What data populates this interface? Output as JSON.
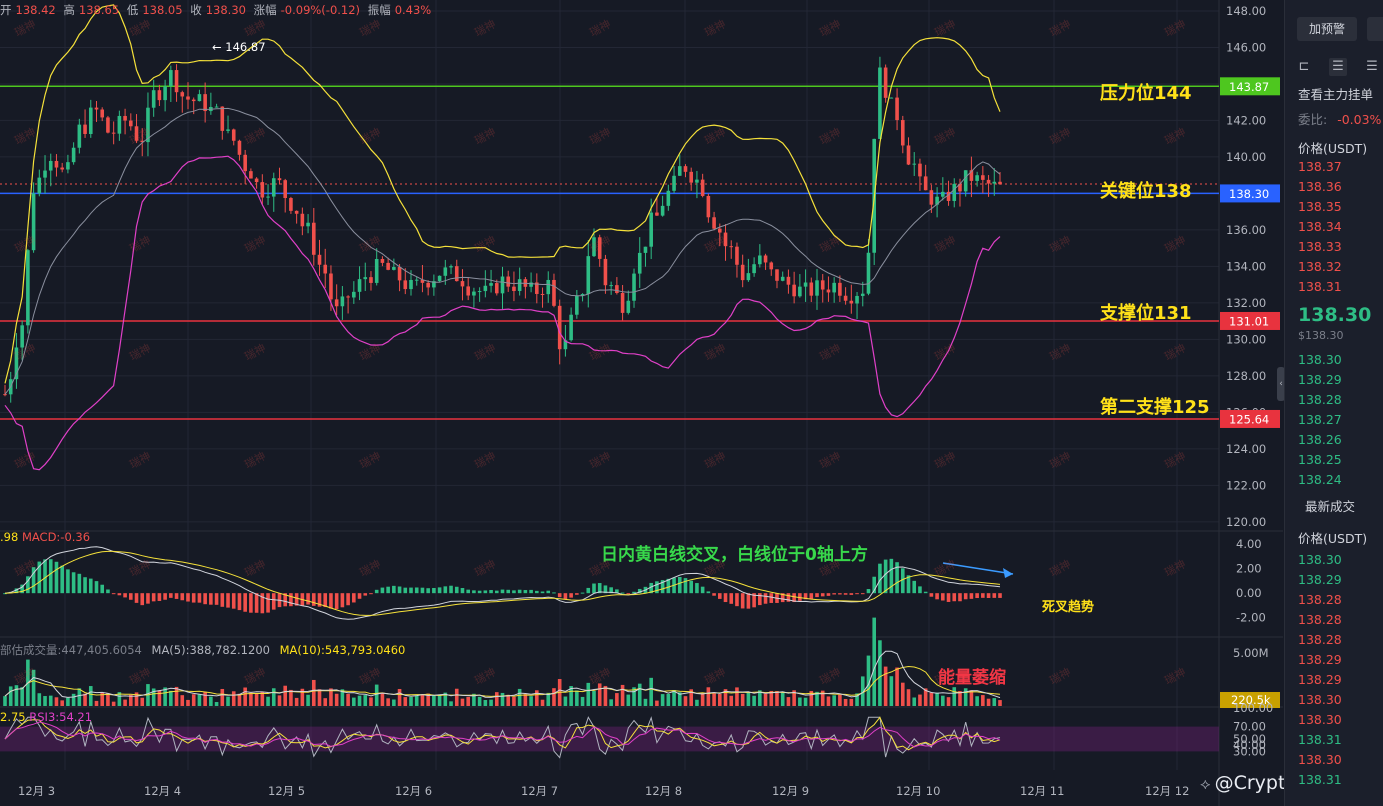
{
  "ohlc": {
    "open_label": "开",
    "open": "138.42",
    "high_label": "高",
    "high": "138.65",
    "low_label": "低",
    "low": "138.05",
    "close_label": "收",
    "close": "138.30",
    "change_label": "涨幅",
    "change": "-0.09%(-0.12)",
    "amp_label": "振幅",
    "amp": "0.43%"
  },
  "annotations": {
    "resistance": "压力位144",
    "key": "关键位138",
    "support": "支撑位131",
    "support2": "第二支撑125",
    "macd_note": "日内黄白线交叉，白线位于0轴上方",
    "death_cross": "死叉趋势",
    "volume_note": "能量萎缩"
  },
  "indicators": {
    "macd_prefix": ".98",
    "macd_label": "MACD:-0.36",
    "vol_label": "部估成交量:447,405.6054",
    "ma5_label": "MA(5):388,782.1200",
    "ma10_label": "MA(10):543,793.0460",
    "rsi_prefix": "2.75",
    "rsi_label": "RSI3:54.21"
  },
  "watermark": "瑞神",
  "brand": "@Crypto瑞神",
  "sidebar": {
    "alert_button": "加预警",
    "order_book_title": "查看主力挂单",
    "ratio_label": "委比:",
    "ratio_value": "-0.03%",
    "price_header": "价格(USDT)",
    "asks": [
      "138.37",
      "138.36",
      "138.35",
      "138.34",
      "138.33",
      "138.32",
      "138.31"
    ],
    "last_price": "138.30",
    "last_price_usd": "$138.30",
    "bids": [
      "138.30",
      "138.29",
      "138.28",
      "138.27",
      "138.26",
      "138.25",
      "138.24"
    ],
    "trades_title": "最新成交",
    "trades_header": "价格(USDT)",
    "trades": [
      {
        "p": "138.30",
        "s": "buy"
      },
      {
        "p": "138.29",
        "s": "buy"
      },
      {
        "p": "138.28",
        "s": "sell"
      },
      {
        "p": "138.28",
        "s": "sell"
      },
      {
        "p": "138.28",
        "s": "sell"
      },
      {
        "p": "138.29",
        "s": "sell"
      },
      {
        "p": "138.29",
        "s": "sell"
      },
      {
        "p": "138.30",
        "s": "sell"
      },
      {
        "p": "138.30",
        "s": "sell"
      },
      {
        "p": "138.31",
        "s": "buy"
      },
      {
        "p": "138.30",
        "s": "sell"
      },
      {
        "p": "138.31",
        "s": "buy"
      }
    ]
  },
  "colors": {
    "up": "#2ebd85",
    "down": "#f0504b",
    "resistance": "#4ec71f",
    "key": "#2962ff",
    "support": "#e8333e",
    "ma_yellow": "#f5e13a",
    "ma_pink": "#e040c8",
    "ma_gray": "#8a8f9e"
  },
  "chart_data": {
    "type": "candlestick",
    "title": "",
    "x_ticks": [
      "12月 3",
      "12月 4",
      "12月 5",
      "12月 6",
      "12月 7",
      "12月 8",
      "12月 9",
      "12月 10",
      "12月 11",
      "12月 12"
    ],
    "y_ticks": [
      "148.00",
      "146.00",
      "144.00",
      "142.00",
      "140.00",
      "138.00",
      "136.00",
      "134.00",
      "132.00",
      "130.00",
      "128.00",
      "126.00",
      "124.00",
      "122.00",
      "120.00"
    ],
    "ylim": [
      119.5,
      148.6
    ],
    "high_marker": "146.87",
    "levels": [
      {
        "name": "压力位144",
        "value": 143.87,
        "label": "143.87",
        "color": "#4ec71f"
      },
      {
        "name": "关键位138",
        "value": 138.0,
        "label": "138.30",
        "color": "#2962ff"
      },
      {
        "name": "支撑位131",
        "value": 131.01,
        "label": "131.01",
        "color": "#e8333e"
      },
      {
        "name": "第二支撑125",
        "value": 125.64,
        "label": "125.64",
        "color": "#e8333e"
      }
    ],
    "close_path": [
      [
        0,
        127.0
      ],
      [
        1,
        130.5
      ],
      [
        2,
        138.5
      ],
      [
        3,
        140.2
      ],
      [
        4,
        139.0
      ],
      [
        5,
        141.5
      ],
      [
        6,
        142.5
      ],
      [
        7,
        141.3
      ],
      [
        8,
        142.0
      ],
      [
        9,
        141.0
      ],
      [
        10,
        143.5
      ],
      [
        11,
        144.5
      ],
      [
        12,
        143.2
      ],
      [
        13,
        143.0
      ],
      [
        14,
        142.4
      ],
      [
        15,
        141.0
      ],
      [
        16,
        139.5
      ],
      [
        17,
        138.2
      ],
      [
        18,
        138.6
      ],
      [
        19,
        137.5
      ],
      [
        20,
        136.0
      ],
      [
        21,
        134.0
      ],
      [
        22,
        131.5
      ],
      [
        23,
        132.5
      ],
      [
        24,
        133.5
      ],
      [
        25,
        134.0
      ],
      [
        26,
        133.4
      ],
      [
        27,
        132.8
      ],
      [
        28,
        133.3
      ],
      [
        29,
        133.7
      ],
      [
        30,
        133.5
      ],
      [
        31,
        132.8
      ],
      [
        32,
        132.5
      ],
      [
        33,
        133.2
      ],
      [
        34,
        133.0
      ],
      [
        35,
        132.6
      ],
      [
        36,
        133.0
      ],
      [
        37,
        129.5
      ],
      [
        38,
        132.0
      ],
      [
        39,
        135.5
      ],
      [
        40,
        133.0
      ],
      [
        41,
        132.0
      ],
      [
        42,
        134.5
      ],
      [
        43,
        136.5
      ],
      [
        44,
        138.0
      ],
      [
        45,
        139.5
      ],
      [
        46,
        138.7
      ],
      [
        47,
        136.5
      ],
      [
        48,
        135.0
      ],
      [
        49,
        133.5
      ],
      [
        50,
        134.3
      ],
      [
        51,
        133.5
      ],
      [
        52,
        133.0
      ],
      [
        53,
        132.6
      ],
      [
        54,
        132.8
      ],
      [
        55,
        133.0
      ],
      [
        56,
        132.5
      ],
      [
        57,
        132.8
      ],
      [
        58,
        144.5
      ],
      [
        59,
        142.5
      ],
      [
        60,
        140.0
      ],
      [
        61,
        138.0
      ],
      [
        62,
        137.5
      ],
      [
        63,
        138.2
      ],
      [
        64,
        138.9
      ],
      [
        65,
        138.5
      ],
      [
        66,
        138.3
      ]
    ],
    "macd_yticks": [
      "4.00",
      "2.00",
      "0.00",
      "-2.00"
    ],
    "vol_yticks": [
      "5.00M"
    ],
    "vol_current": "220.5k",
    "rsi_yticks": [
      "100.00",
      "70.00",
      "50.00",
      "40.00",
      "30.00"
    ]
  }
}
